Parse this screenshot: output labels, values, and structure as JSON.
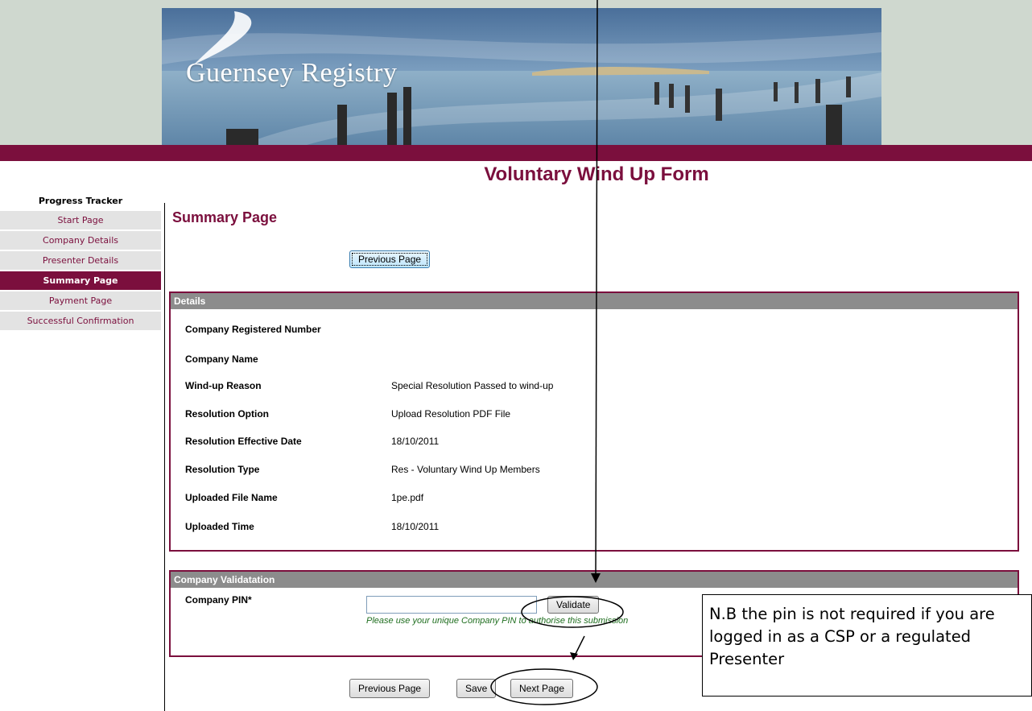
{
  "header": {
    "logo_text": "Guernsey Registry",
    "accent_color": "#7b0f3d"
  },
  "form_title": "Voluntary Wind Up Form",
  "tracker": {
    "title": "Progress Tracker",
    "items": [
      {
        "label": "Start Page",
        "active": false
      },
      {
        "label": "Company Details",
        "active": false
      },
      {
        "label": "Presenter Details",
        "active": false
      },
      {
        "label": "Summary Page",
        "active": true
      },
      {
        "label": "Payment Page",
        "active": false
      },
      {
        "label": "Successful Confirmation",
        "active": false
      }
    ]
  },
  "main": {
    "page_title": "Summary Page",
    "previous_top_label": "Previous Page",
    "details": {
      "heading": "Details",
      "rows": [
        {
          "label": "Company Registered Number",
          "value": ""
        },
        {
          "label": "Company Name",
          "value": ""
        },
        {
          "label": "Wind-up Reason",
          "value": "Special Resolution Passed to wind-up"
        },
        {
          "label": "Resolution Option",
          "value": "Upload Resolution PDF File"
        },
        {
          "label": "Resolution Effective Date",
          "value": "18/10/2011"
        },
        {
          "label": "Resolution Type",
          "value": "Res - Voluntary Wind Up Members"
        },
        {
          "label": "Uploaded File Name",
          "value": "1pe.pdf"
        },
        {
          "label": "Uploaded Time",
          "value": "18/10/2011"
        }
      ]
    },
    "validation": {
      "heading": "Company Validatation",
      "pin_label": "Company PIN*",
      "pin_value": "",
      "validate_label": "Validate",
      "hint": "Please use your unique Company PIN to authorise this submission"
    },
    "footer_buttons": {
      "previous_label": "Previous Page",
      "save_label": "Save",
      "next_label": "Next Page"
    }
  },
  "annotation": {
    "note": "N.B the pin is not required if you are logged in as a CSP or a regulated Presenter"
  }
}
